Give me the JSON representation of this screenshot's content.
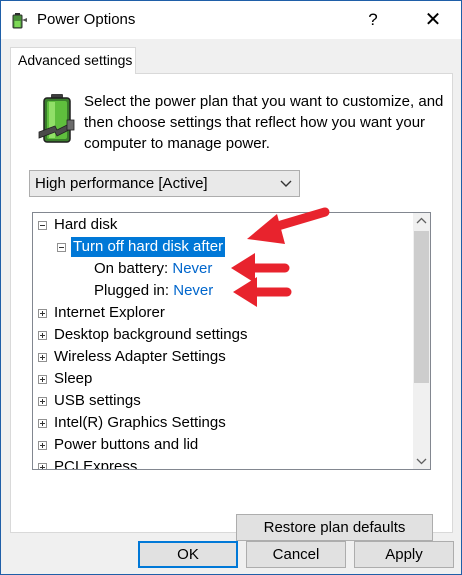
{
  "window": {
    "title": "Power Options",
    "help_glyph": "?",
    "close_glyph": "✕"
  },
  "tab": {
    "label": "Advanced settings"
  },
  "description": "Select the power plan that you want to customize, and then choose settings that reflect how you want your computer to manage power.",
  "plan_select": {
    "value": "High performance [Active]"
  },
  "tree": {
    "hard_disk": "Hard disk",
    "turn_off": "Turn off hard disk after",
    "on_battery_label": "On battery:",
    "on_battery_value": "Never",
    "plugged_in_label": "Plugged in:",
    "plugged_in_value": "Never",
    "items": [
      "Internet Explorer",
      "Desktop background settings",
      "Wireless Adapter Settings",
      "Sleep",
      "USB settings",
      "Intel(R) Graphics Settings",
      "Power buttons and lid",
      "PCI Express"
    ]
  },
  "buttons": {
    "restore": "Restore plan defaults",
    "ok": "OK",
    "cancel": "Cancel",
    "apply": "Apply"
  },
  "colors": {
    "selection": "#0078d7",
    "link": "#0066cc",
    "annotation_arrow": "#e8232d"
  }
}
